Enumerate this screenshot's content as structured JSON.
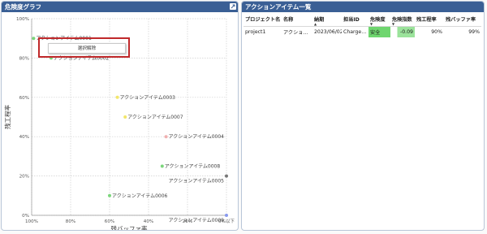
{
  "left_panel": {
    "title": "危険度グラフ",
    "expand_icon": "expand-icon"
  },
  "context_menu": {
    "item_label": "選択解除"
  },
  "chart_data": {
    "type": "scatter",
    "xlabel": "残バッファ率",
    "ylabel": "残工程率",
    "x_reversed": true,
    "x_ticks": [
      "100%",
      "80%",
      "60%",
      "40%",
      "20%",
      "0%以下"
    ],
    "y_ticks": [
      "0%",
      "20%",
      "40%",
      "60%",
      "80%",
      "100%"
    ],
    "xlim": [
      0,
      100
    ],
    "ylim": [
      0,
      100
    ],
    "grid": true,
    "points": [
      {
        "label": "アクションアイテム0001",
        "x": 99,
        "y": 90,
        "color": "#7bd67b"
      },
      {
        "label": "アクションアイテム0002",
        "x": 90,
        "y": 80,
        "color": "#7bd67b"
      },
      {
        "label": "アクションアイテム0003",
        "x": 56,
        "y": 60,
        "color": "#f2e66a"
      },
      {
        "label": "アクションアイテム0007",
        "x": 52,
        "y": 50,
        "color": "#f2e66a"
      },
      {
        "label": "アクションアイテム0004",
        "x": 31,
        "y": 40,
        "color": "#f0b0b0"
      },
      {
        "label": "アクションアイテム0008",
        "x": 33,
        "y": 25,
        "color": "#7bd67b"
      },
      {
        "label": "アクションアイテム0005",
        "x": 0,
        "y": 20,
        "color": "#777777"
      },
      {
        "label": "アクションアイテム0006",
        "x": 60,
        "y": 10,
        "color": "#7bd67b"
      },
      {
        "label": "アクションアイテム0009",
        "x": 0,
        "y": 0,
        "color": "#8899ee"
      }
    ]
  },
  "right_panel": {
    "title": "アクションアイテム一覧",
    "columns": [
      "プロジェクト名",
      "名称",
      "納期",
      "担当ID",
      "危険度",
      "危険指数",
      "残工程率",
      "残バッファ率"
    ],
    "rows": [
      [
        "project1",
        "アクショ…",
        "2023/06/02",
        "Charge…",
        "安全",
        "-0.09",
        "90%",
        "99%"
      ]
    ]
  },
  "colors": {
    "header_bg": "#3a5f95",
    "safe": "#6fd66f",
    "menu_frame": "#c0292b"
  }
}
